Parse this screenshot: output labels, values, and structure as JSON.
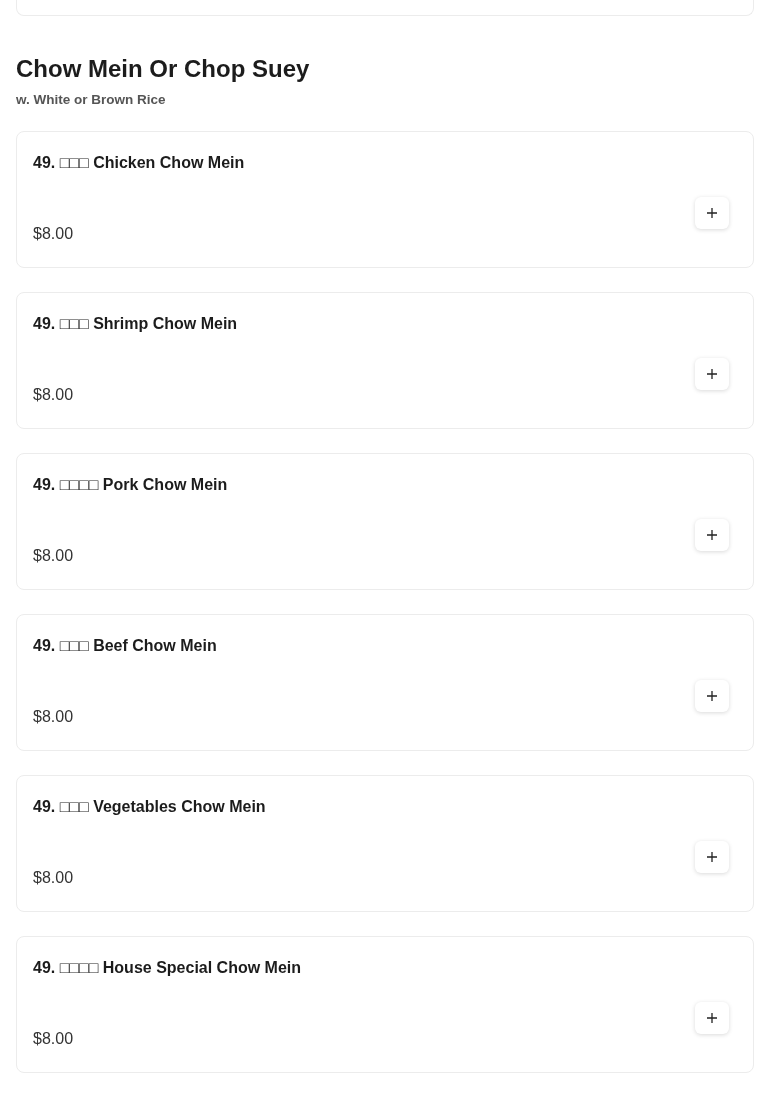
{
  "section": {
    "title": "Chow Mein Or Chop Suey",
    "subtitle": "w. White or Brown Rice"
  },
  "items": [
    {
      "name": "49. □□□ Chicken Chow Mein",
      "price": "$8.00"
    },
    {
      "name": "49. □□□ Shrimp Chow Mein",
      "price": "$8.00"
    },
    {
      "name": "49. □□□□ Pork Chow Mein",
      "price": "$8.00"
    },
    {
      "name": "49. □□□ Beef Chow Mein",
      "price": "$8.00"
    },
    {
      "name": "49. □□□ Vegetables Chow Mein",
      "price": "$8.00"
    },
    {
      "name": "49. □□□□ House Special Chow Mein",
      "price": "$8.00"
    }
  ]
}
